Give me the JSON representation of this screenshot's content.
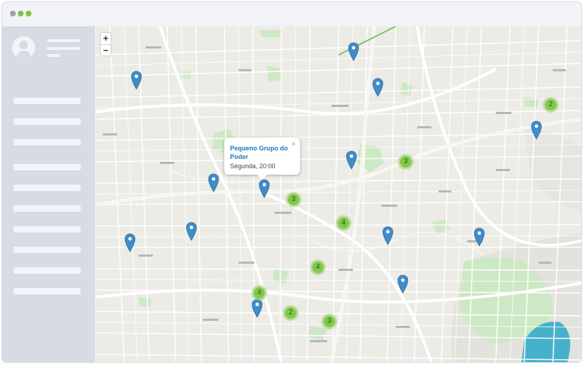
{
  "window": {
    "dots": [
      "#9a9fa8",
      "#7bc043",
      "#7bc043"
    ]
  },
  "map": {
    "zoom_in": "+",
    "zoom_out": "−",
    "popup": {
      "title": "Pequeno Grupo do Poder",
      "detail": "Segunda, 20:00",
      "close": "×"
    },
    "clusters": [
      "2",
      "3",
      "3",
      "4",
      "4",
      "4",
      "2",
      "3"
    ],
    "colors": {
      "pin": "#3f8cc8",
      "cluster": "#80c94a",
      "park": "#cde8c4",
      "water": "#2aa8c8"
    }
  }
}
